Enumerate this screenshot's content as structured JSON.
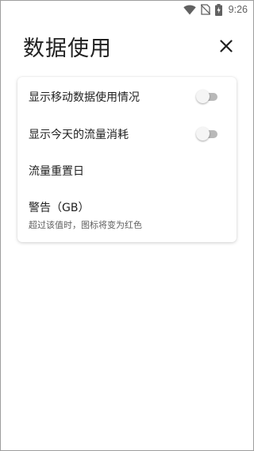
{
  "status_bar": {
    "time": "9:26",
    "icons": [
      "wifi-icon",
      "no-sim-icon",
      "battery-charging-icon"
    ]
  },
  "header": {
    "title": "数据使用",
    "close_icon": "close-icon"
  },
  "settings": {
    "show_mobile_data_usage": {
      "label": "显示移动数据使用情况",
      "enabled": false
    },
    "show_today_usage": {
      "label": "显示今天的流量消耗",
      "enabled": false
    },
    "reset_day": {
      "label": "流量重置日"
    },
    "warning": {
      "label": "警告（GB）",
      "description": "超过该值时，图标将变为红色"
    }
  },
  "colors": {
    "text_primary": "#212121",
    "text_secondary": "#616161",
    "toggle_track_off": "#b9b9b9",
    "toggle_thumb_off": "#f5f5f5"
  }
}
